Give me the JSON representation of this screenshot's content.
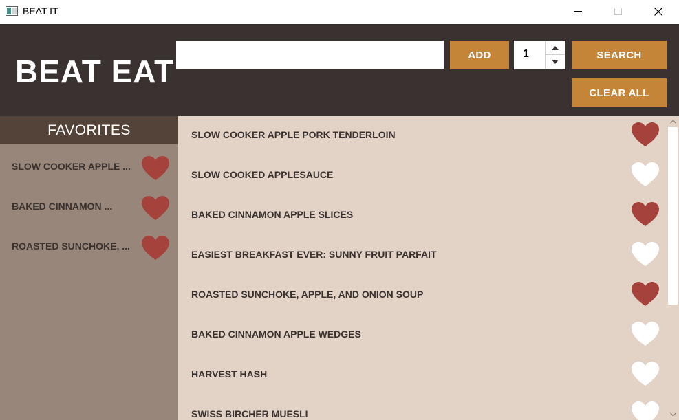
{
  "window": {
    "title": "BEAT IT",
    "icon": "app-window-icon"
  },
  "header": {
    "logo": "BEAT EAT",
    "search_value": "",
    "add_label": "ADD",
    "stepper_value": "1",
    "search_label": "SEARCH",
    "clear_label": "CLEAR ALL"
  },
  "favorites": {
    "title": "FAVORITES",
    "items": [
      {
        "label": "SLOW COOKER APPLE ...",
        "favorited": true
      },
      {
        "label": "BAKED CINNAMON ...",
        "favorited": true
      },
      {
        "label": "ROASTED SUNCHOKE, ...",
        "favorited": true
      }
    ]
  },
  "results": [
    {
      "label": "SLOW COOKER APPLE PORK TENDERLOIN",
      "favorited": true
    },
    {
      "label": "SLOW COOKED APPLESAUCE",
      "favorited": false
    },
    {
      "label": "BAKED CINNAMON APPLE SLICES",
      "favorited": true
    },
    {
      "label": "EASIEST BREAKFAST EVER: SUNNY FRUIT PARFAIT",
      "favorited": false
    },
    {
      "label": "ROASTED SUNCHOKE, APPLE, AND ONION SOUP",
      "favorited": true
    },
    {
      "label": "BAKED CINNAMON APPLE WEDGES",
      "favorited": false
    },
    {
      "label": "HARVEST HASH",
      "favorited": false
    },
    {
      "label": "SWISS BIRCHER MUESLI",
      "favorited": false
    }
  ],
  "colors": {
    "header_bg": "#3a3230",
    "accent": "#c48538",
    "sidebar_bg": "#978679",
    "sidebar_header_bg": "#544338",
    "list_bg": "#e2d3c6",
    "heart_on": "#a5423b",
    "heart_off": "#ffffff",
    "text_dark": "#3a3230"
  },
  "icons": {
    "favorite": "heart-icon",
    "minimize": "minimize-icon",
    "maximize": "maximize-icon",
    "close": "close-icon",
    "spin_up": "chevron-up-icon",
    "spin_down": "chevron-down-icon"
  }
}
